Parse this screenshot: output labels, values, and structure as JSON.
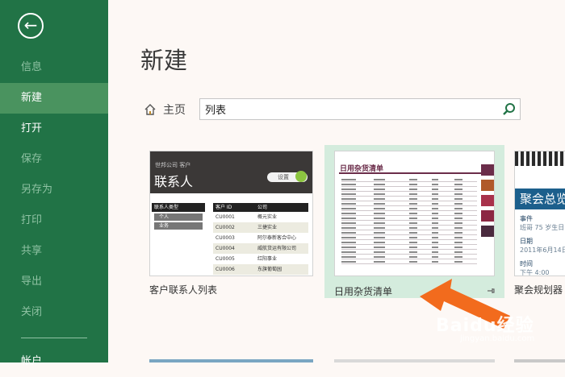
{
  "sidebar": {
    "nav": [
      {
        "label": "信息"
      },
      {
        "label": "新建"
      },
      {
        "label": "打开"
      },
      {
        "label": "保存"
      },
      {
        "label": "另存为"
      },
      {
        "label": "打印"
      },
      {
        "label": "共享"
      },
      {
        "label": "导出"
      },
      {
        "label": "关闭"
      },
      {
        "label": "帐户"
      }
    ],
    "active_color": "#4a935f",
    "bg_color": "#217346"
  },
  "main": {
    "title": "新建",
    "home_label": "主页",
    "search_value": "列表",
    "templates": [
      {
        "label": "客户联系人列表",
        "subtitle": "世邦公司 客户",
        "title": "联系人",
        "button": "设置",
        "filter_header": "联系人类型",
        "filter_items": [
          "个人",
          "业务"
        ],
        "columns": [
          "客户 ID",
          "公司"
        ],
        "rows": [
          [
            "CU0001",
            "概元实业"
          ],
          [
            "CU0002",
            "三捷实业"
          ],
          [
            "CU0003",
            "阿尔泰新客合中心"
          ],
          [
            "CU0004",
            "威航货运有限公司"
          ],
          [
            "CU0005",
            "红阳事业"
          ],
          [
            "CU0006",
            "东旗葡萄园"
          ]
        ]
      },
      {
        "label": "日用杂货清单",
        "title": "日用杂货清单"
      },
      {
        "label": "聚会规划器",
        "title": "聚会总览",
        "fields": [
          {
            "label": "事件",
            "value": "班哥 75 岁生日"
          },
          {
            "label": "日期",
            "value": "2011年6月14日"
          },
          {
            "label": "时间",
            "value": "下午 4:00"
          }
        ]
      }
    ]
  },
  "watermark": {
    "text": "Baidu经验",
    "sub": "jingyan.baidu.com"
  }
}
